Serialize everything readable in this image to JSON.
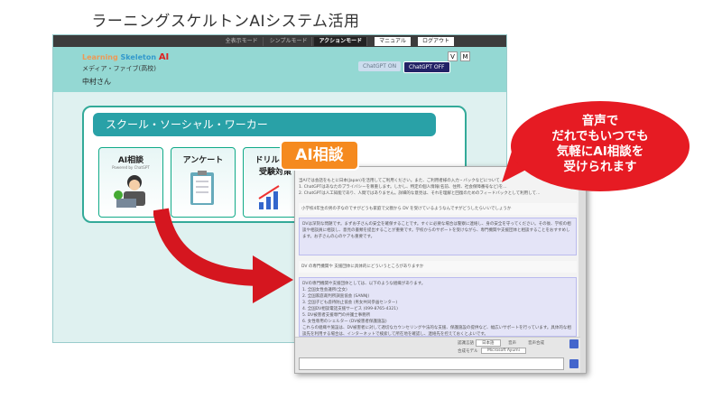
{
  "page_title": "ラーニングスケルトンAIシステム活用",
  "toolbar": {
    "mode1": "全表示モード",
    "mode2": "シンプルモード",
    "mode3": "アクションモード",
    "manual": "マニュアル",
    "logout": "ログアウト"
  },
  "header": {
    "logo_a": "Learning",
    "logo_b": "Skeleton",
    "logo_ai": "AI",
    "org": "メディア・ファイブ(高校)",
    "user": "中村さん",
    "v": "V",
    "m": "M",
    "gpt_on": "ChatGPT ON",
    "gpt_off": "ChatGPT OFF"
  },
  "card": {
    "title": "スクール・ソーシャル・ワーカー",
    "tiles": [
      {
        "label": "AI相談",
        "sub": "Powered by ChatGPT"
      },
      {
        "label": "アンケート"
      },
      {
        "label": "ドリル基礎"
      },
      {
        "label": "受験対策"
      }
    ]
  },
  "ai_tag": "AI相談",
  "chat": {
    "header": "Mr",
    "notice1": "当AIでは会話をもとに日本(Japan)を活用してご利用ください。また、ご利用者様の入力・バックなどについて…",
    "notice2": "1. ChatGPTはあなたのプライバシーを尊重します。しかし、特定の個人情報(名前、住所、社会保障番号など)を…",
    "notice3": "2. ChatGPTは人工知能であり、人間ではありません。詳細的な意見は、それを理解と回復のためのフィードバックとして利用して…",
    "q1": "小学校4年生の男の子なのですがどうも家庭で父親から DV を受けているようなんですがどうしたらいいでしょうか",
    "a1": "DVは深刻な問題です。まずお子さんの安全を確保することです。すぐに必要な場合は警察に連絡し、身の安全を守ってください。その後、学校の相談や相談員に相談し、意見の書類を提出することが重要です。学校からのサポートを受けながら、専門機関や支援団体と相談することをおすすめします。お子さんの心のケアも重要です。",
    "q2": "DV の専門機関や 支援団体に具体的にどういうところがありますか",
    "a2_intro": "DVの専門機関や支援団体としては、以下のような組織があります。",
    "a2_list": [
      "1. 全国女性会議所(全女)",
      "2. 全国家庭裁判所調査協会 (SANNJ)",
      "3. 全国子ども虐待防止協会 (男女共同参画センター)",
      "4. 全国DV相談電話支援サービス (099-8765-4321)",
      "5. DV被害者支援専門の弁護士事務所",
      "6. 女性専用のシェルター (DV被害者保護施設)"
    ],
    "a2_outro": "これらの組織や施設は、DV被害者に対して適切なカウンセリングや法的な支援、保護施設の提供など、幅広いサポートを行っています。具体的な相談先を利用する場合は、インターネットで検索して所在地を確認し、連絡先を控えておくとよいです。",
    "lang_label": "認識言語",
    "lang_value": "日本語",
    "opt1": "音声",
    "opt2": "音声合成",
    "model_label": "合成モデル",
    "model_value": "Microsoft Ayumi"
  },
  "speech": {
    "l1": "音声で",
    "l2": "だれでもいつでも",
    "l3": "気軽にAI相談を",
    "l4": "受けられます"
  }
}
